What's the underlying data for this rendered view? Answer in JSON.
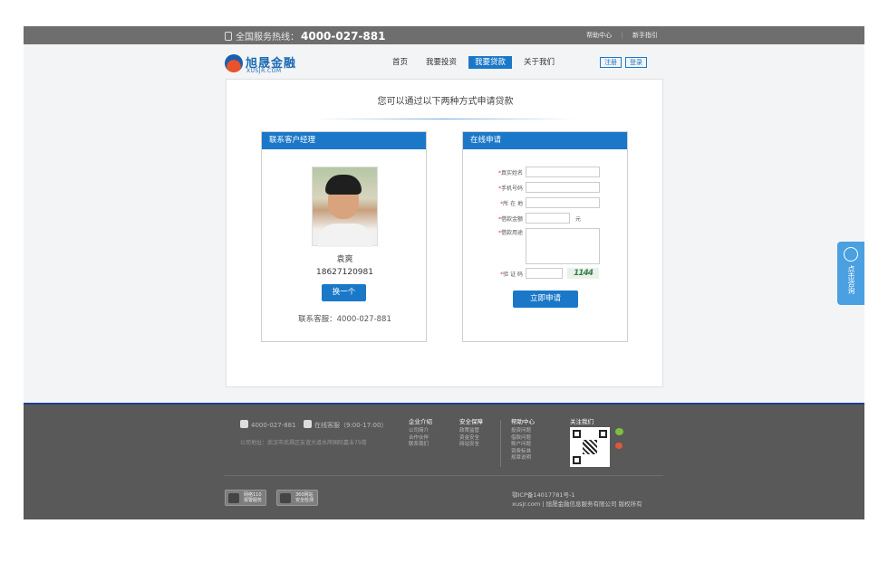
{
  "topbar": {
    "hotline_label": "全国服务热线：",
    "hotline_number": "4000-027-881",
    "links": [
      "帮助中心",
      "新手指引"
    ]
  },
  "logo": {
    "cn": "旭晟金融",
    "en": "XUSJR.COM"
  },
  "nav": {
    "items": [
      {
        "label": "首页",
        "active": false
      },
      {
        "label": "我要投资",
        "active": false
      },
      {
        "label": "我要贷款",
        "active": true
      },
      {
        "label": "关于我们",
        "active": false
      }
    ],
    "register_label": "注册",
    "login_label": "登录"
  },
  "main": {
    "title": "您可以通过以下两种方式申请贷款",
    "contact": {
      "heading": "联系客户经理",
      "name": "袁爽",
      "phone": "18627120981",
      "swap_label": "换一个",
      "service_line": "联系客服：4000-027-881"
    },
    "apply": {
      "heading": "在线申请",
      "fields": {
        "name": "真实姓名",
        "mobile": "手机号码",
        "location": "所 在 地",
        "amount": "借款金额",
        "amount_unit": "元",
        "purpose": "借款用途",
        "captcha": "验 证 码"
      },
      "captcha_text": "1144",
      "submit_label": "立即申请"
    }
  },
  "side_tab": {
    "label": "点击咨询"
  },
  "footer": {
    "phone": "4000-027-881",
    "online": "在线客服（9:00-17:00）",
    "address": "公司地址：武汉市武昌区友谊大道水岸国际嘉业75楼",
    "columns": [
      {
        "title": "企业介绍",
        "items": [
          "公司简介",
          "合作伙伴",
          "联系我们"
        ]
      },
      {
        "title": "安全保障",
        "items": [
          "政策监管",
          "资金安全",
          "网站安全"
        ]
      },
      {
        "title": "帮助中心",
        "items": [
          "投资问题",
          "借款问题",
          "账户问题",
          "资费标准",
          "规章说明"
        ]
      }
    ],
    "follow_label": "关注我们",
    "badges": [
      {
        "line1": "网络110",
        "line2": "报警服务"
      },
      {
        "line1": "360网站",
        "line2": "安全检测"
      }
    ],
    "icp": "鄂ICP备14017781号-1",
    "copyright": "xusjr.com | 旭晟金融信息服务有限公司 版权所有"
  },
  "colors": {
    "brand_blue": "#1b78c9",
    "topbar_gray": "#6e6e6e",
    "footer_gray": "#595959",
    "accent_navy": "#1b3f8f"
  }
}
